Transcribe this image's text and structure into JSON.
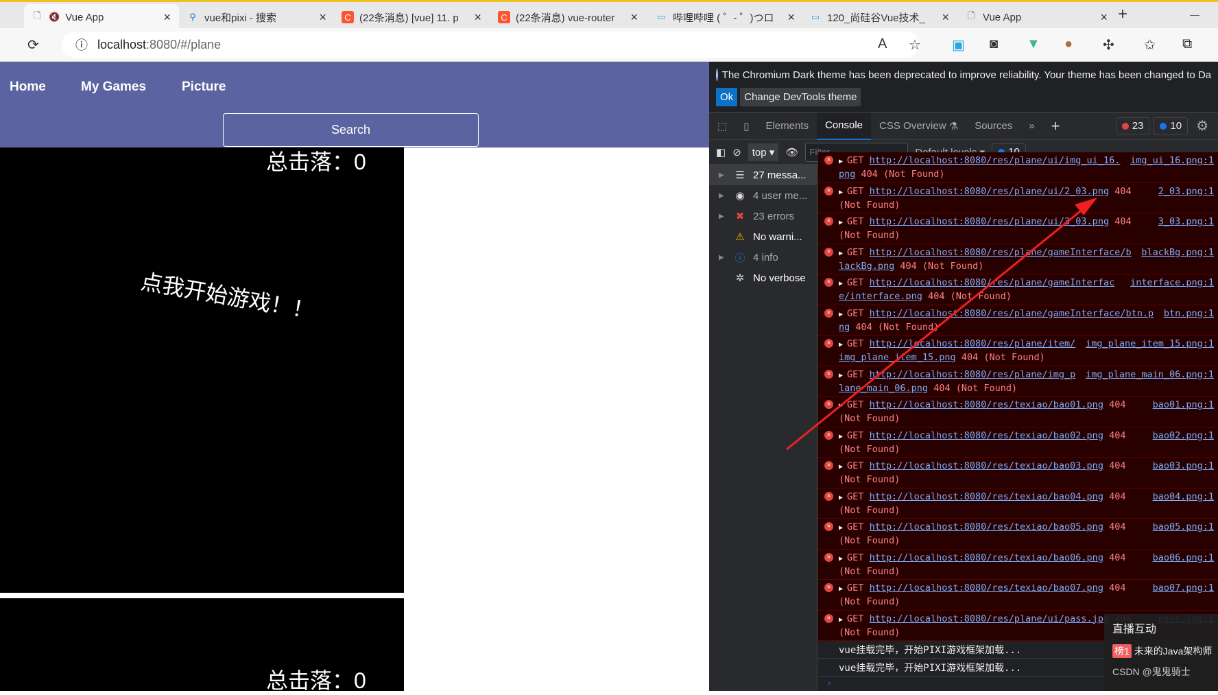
{
  "browser": {
    "tabs": [
      {
        "title": "Vue App",
        "icon": "page-icon",
        "muted": true,
        "active": true
      },
      {
        "title": "vue和pixi - 搜索",
        "icon": "search-icon"
      },
      {
        "title": "(22条消息) [vue] 11. p",
        "icon": "csdn-icon"
      },
      {
        "title": "(22条消息) vue-router",
        "icon": "csdn-icon"
      },
      {
        "title": "哔哩哔哩 ( ゜- ゜)つロ",
        "icon": "bilibili-icon"
      },
      {
        "title": "120_尚硅谷Vue技术_",
        "icon": "bilibili-icon"
      },
      {
        "title": "Vue App",
        "icon": "page-icon"
      }
    ],
    "url_host": "localhost",
    "url_rest": ":8080/#/plane"
  },
  "page": {
    "nav": [
      "Home",
      "My Games",
      "Picture"
    ],
    "search_label": "Search",
    "score": "总击落：0",
    "start": "点我开始游戏！！",
    "colors": {
      "nav": "#5b64a0",
      "canvas": "#000000"
    }
  },
  "devtools": {
    "info": "The Chromium Dark theme has been deprecated to improve reliability. Your theme has been changed to Da",
    "ok": "Ok",
    "change_theme": "Change DevTools theme",
    "tabs": [
      "Elements",
      "Console",
      "CSS Overview",
      "Sources"
    ],
    "error_count": "23",
    "info_count": "10",
    "context": "top",
    "filter_placeholder": "Filter",
    "levels": "Default levels",
    "issues": "10",
    "sidebar": [
      {
        "label": "27 messa...",
        "icon": "list-icon",
        "expand": true
      },
      {
        "label": "4 user me...",
        "icon": "user-icon",
        "expand": true
      },
      {
        "label": "23 errors",
        "icon": "error-icon",
        "expand": true
      },
      {
        "label": "No warni...",
        "icon": "warning-icon",
        "expand": false
      },
      {
        "label": "4 info",
        "icon": "info-icon",
        "expand": true
      },
      {
        "label": "No verbose",
        "icon": "bug-icon",
        "expand": false
      }
    ],
    "messages": [
      {
        "url": "http://localhost:8080/res/plane/ui/img_ui_16.png",
        "src": "img_ui_16.png:1"
      },
      {
        "url": "http://localhost:8080/res/plane/ui/2_03.png",
        "src": "2_03.png:1"
      },
      {
        "url": "http://localhost:8080/res/plane/ui/3_03.png",
        "src": "3_03.png:1"
      },
      {
        "url": "http://localhost:8080/res/plane/gameInterface/blackBg.png",
        "src": "blackBg.png:1"
      },
      {
        "url": "http://localhost:8080/res/plane/gameInterface/interface.png",
        "src": "interface.png:1"
      },
      {
        "url": "http://localhost:8080/res/plane/gameInterface/btn.png",
        "src": "btn.png:1"
      },
      {
        "url": "http://localhost:8080/res/plane/item/img_plane_item_15.png",
        "src": "img_plane_item_15.png:1"
      },
      {
        "url": "http://localhost:8080/res/plane/img_plane_main_06.png",
        "src": "img_plane_main_06.png:1"
      },
      {
        "url": "http://localhost:8080/res/texiao/bao01.png",
        "src": "bao01.png:1"
      },
      {
        "url": "http://localhost:8080/res/texiao/bao02.png",
        "src": "bao02.png:1"
      },
      {
        "url": "http://localhost:8080/res/texiao/bao03.png",
        "src": "bao03.png:1"
      },
      {
        "url": "http://localhost:8080/res/texiao/bao04.png",
        "src": "bao04.png:1"
      },
      {
        "url": "http://localhost:8080/res/texiao/bao05.png",
        "src": "bao05.png:1"
      },
      {
        "url": "http://localhost:8080/res/texiao/bao06.png",
        "src": "bao06.png:1"
      },
      {
        "url": "http://localhost:8080/res/texiao/bao07.png",
        "src": "bao07.png:1"
      },
      {
        "url": "http://localhost:8080/res/plane/ui/pass.jpg",
        "src": "pass.jpg:1"
      }
    ],
    "method": "GET",
    "status": "404 (Not Found)",
    "logs": [
      "vue挂载完毕，开始PIXI游戏框架加载...",
      "vue挂载完毕，开始PIXI游戏框架加载..."
    ]
  },
  "overlay": {
    "title": "直播互动",
    "rank": "榜1",
    "user": "未来的Java架构师",
    "watermark": "CSDN @鬼鬼骑士"
  }
}
